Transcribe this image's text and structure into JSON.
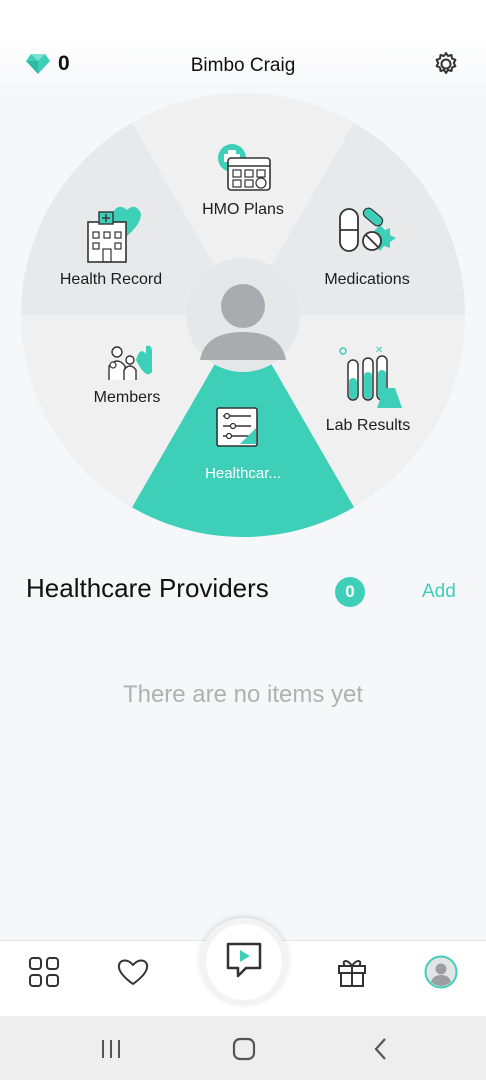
{
  "header": {
    "gem_count": "0",
    "user_name": "Bimbo Craig"
  },
  "wheel": {
    "segments": [
      {
        "label": "HMO Plans",
        "icon": "calendar-plus-icon",
        "active": false
      },
      {
        "label": "Medications",
        "icon": "pills-icon",
        "active": false
      },
      {
        "label": "Lab Results",
        "icon": "test-tubes-icon",
        "active": false
      },
      {
        "label": "Healthcar...",
        "icon": "provider-list-icon",
        "active": true
      },
      {
        "label": "Members",
        "icon": "family-icon",
        "active": false
      },
      {
        "label": "Health Record",
        "icon": "hospital-heart-icon",
        "active": false
      }
    ],
    "avatar_icon": "user-avatar-icon"
  },
  "providers": {
    "title": "Healthcare Providers",
    "count": "0",
    "add_label": "Add",
    "empty_text": "There are no items yet"
  },
  "bottom_nav": {
    "items": [
      "grid-icon",
      "heart-icon",
      "play-chat-icon",
      "gift-icon",
      "profile-icon"
    ]
  },
  "system_nav": {
    "items": [
      "recents-icon",
      "home-icon",
      "back-icon"
    ]
  },
  "colors": {
    "accent": "#3ecfb9",
    "segment_gray": "#e8e9eb",
    "segment_light": "#f0f0f1"
  }
}
